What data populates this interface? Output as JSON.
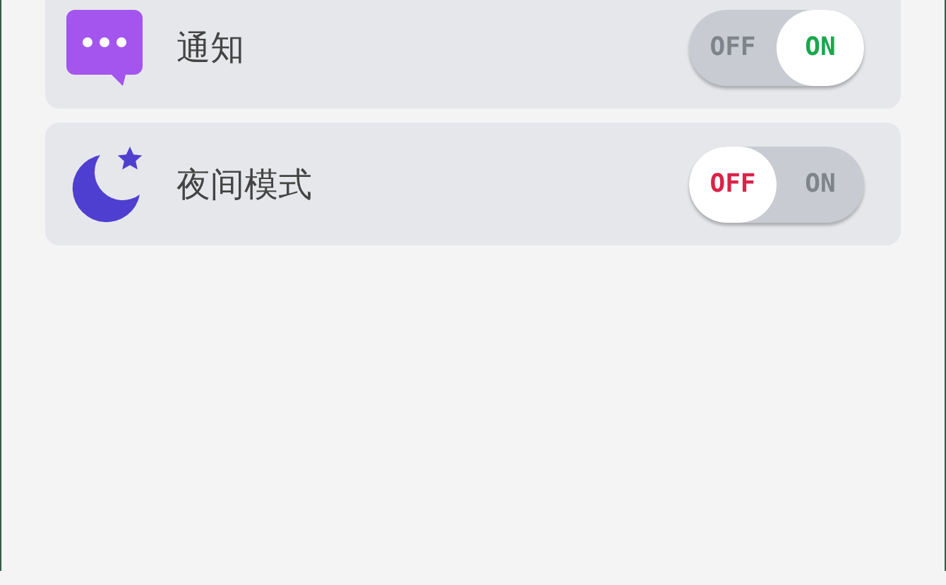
{
  "settings": [
    {
      "kind": "chat",
      "label": "通知",
      "off_label": "OFF",
      "on_label": "ON",
      "on": true
    },
    {
      "kind": "moon",
      "label": "夜间模式",
      "off_label": "OFF",
      "on_label": "ON",
      "on": false
    }
  ]
}
